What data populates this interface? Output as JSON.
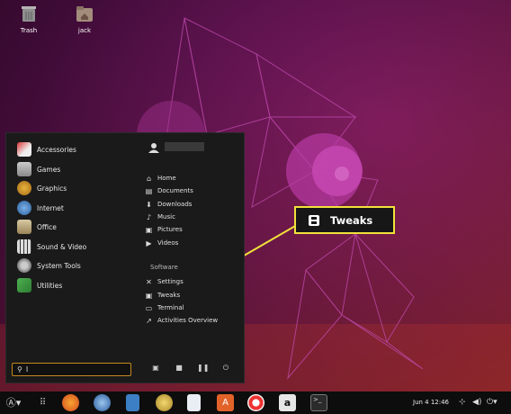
{
  "desktop": {
    "icons": [
      {
        "label": "Trash",
        "icon": "trash-icon"
      },
      {
        "label": "jack",
        "icon": "home-folder-icon"
      }
    ]
  },
  "menu": {
    "categories": [
      {
        "label": "Accessories",
        "icon": "accessories-icon"
      },
      {
        "label": "Games",
        "icon": "games-icon"
      },
      {
        "label": "Graphics",
        "icon": "graphics-icon"
      },
      {
        "label": "Internet",
        "icon": "internet-icon"
      },
      {
        "label": "Office",
        "icon": "office-icon"
      },
      {
        "label": "Sound & Video",
        "icon": "sound-video-icon"
      },
      {
        "label": "System Tools",
        "icon": "system-tools-icon"
      },
      {
        "label": "Utilities",
        "icon": "utilities-icon"
      }
    ],
    "places": [
      {
        "label": "Home",
        "icon": "home-icon"
      },
      {
        "label": "Documents",
        "icon": "documents-icon"
      },
      {
        "label": "Downloads",
        "icon": "downloads-icon"
      },
      {
        "label": "Music",
        "icon": "music-icon"
      },
      {
        "label": "Pictures",
        "icon": "pictures-icon"
      },
      {
        "label": "Videos",
        "icon": "videos-icon"
      }
    ],
    "software_label": "Software",
    "software": [
      {
        "label": "Settings",
        "icon": "settings-icon"
      },
      {
        "label": "Tweaks",
        "icon": "tweaks-icon"
      },
      {
        "label": "Terminal",
        "icon": "terminal-icon"
      },
      {
        "label": "Activities Overview",
        "icon": "activities-icon"
      }
    ],
    "search": {
      "value": "I"
    },
    "system_buttons": [
      "lock-screen-icon",
      "lock-icon",
      "suspend-icon",
      "power-icon"
    ]
  },
  "callout": {
    "label": "Tweaks",
    "border_color": "#f0e23a"
  },
  "taskbar": {
    "apps": [
      "menu-button-icon",
      "app-grid-icon",
      "firefox-icon",
      "thunderbird-icon",
      "libreoffice-writer-icon",
      "rhythmbox-icon",
      "libreoffice-impress-icon",
      "software-center-icon",
      "help-icon",
      "amazon-icon",
      "terminal-icon"
    ],
    "clock": "Jun 4  12:46",
    "tray": [
      "network-icon",
      "volume-icon",
      "power-status-icon"
    ]
  }
}
